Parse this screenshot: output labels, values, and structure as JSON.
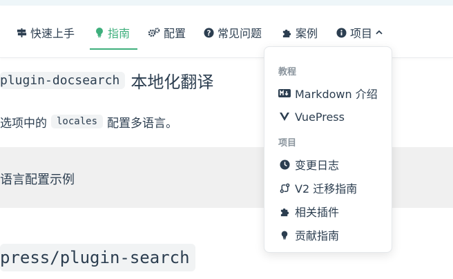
{
  "navbar": {
    "items": [
      {
        "label": "快速上手",
        "icon": "signpost-icon"
      },
      {
        "label": "指南",
        "icon": "lightbulb-icon",
        "active": true
      },
      {
        "label": "配置",
        "icon": "gears-icon"
      },
      {
        "label": "常见问题",
        "icon": "question-circle-icon"
      },
      {
        "label": "案例",
        "icon": "puzzle-icon"
      },
      {
        "label": "项目",
        "icon": "info-circle-icon",
        "dropdown": true
      }
    ],
    "accent_color": "#3eaf7c"
  },
  "content": {
    "heading_code": "plugin-docsearch",
    "heading_text": "本地化翻译",
    "para_before": "选项中的",
    "para_code": "locales",
    "para_after": "配置多语言。",
    "block_text": "语言配置示例",
    "heading2_code": "press/plugin-search"
  },
  "dropdown": {
    "groups": [
      {
        "title": "教程",
        "items": [
          {
            "label": "Markdown 介绍",
            "icon": "markdown-icon"
          },
          {
            "label": "VuePress",
            "icon": "vue-icon"
          }
        ]
      },
      {
        "title": "项目",
        "items": [
          {
            "label": "变更日志",
            "icon": "clock-icon"
          },
          {
            "label": "V2 迁移指南",
            "icon": "git-compare-icon"
          },
          {
            "label": "相关插件",
            "icon": "puzzle-icon"
          },
          {
            "label": "贡献指南",
            "icon": "lightbulb-icon"
          }
        ]
      }
    ]
  }
}
